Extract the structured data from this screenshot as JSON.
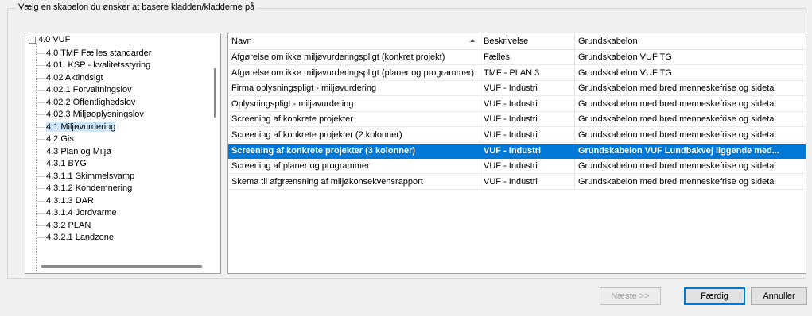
{
  "group_title": "Vælg en skabelon du ønsker at basere kladden/kladderne på",
  "tree": {
    "root": "4.0 VUF",
    "items": [
      "4.0 TMF Fælles standarder",
      "4.01. KSP - kvalitetsstyring",
      "4.02 Aktindsigt",
      "4.02.1 Forvaltningslov",
      "4.02.2 Offentlighedslov",
      "4.02.3 Miljøoplysningslov",
      "4.1 Miljøvurdering",
      "4.2 Gis",
      "4.3 Plan og Miljø",
      "4.3.1 BYG",
      "4.3.1.1 Skimmelsvamp",
      "4.3.1.2 Kondemnering",
      "4.3.1.3 DAR",
      "4.3.1.4 Jordvarme",
      "4.3.2 PLAN",
      "4.3.2.1 Landzone"
    ],
    "selected_index": 6
  },
  "list": {
    "columns": [
      "Navn",
      "Beskrivelse",
      "Grundskabelon"
    ],
    "rows": [
      [
        "Afgørelse om ikke miljøvurderingspligt (konkret projekt)",
        "Fælles",
        "Grundskabelon VUF TG"
      ],
      [
        "Afgørelse om ikke miljøvurderingspligt (planer og programmer)",
        "TMF - PLAN 3",
        "Grundskabelon VUF TG"
      ],
      [
        "Firma oplysningspligt - miljøvurdering",
        "VUF - Industri",
        "Grundskabelon med bred menneskefrise og sidetal"
      ],
      [
        "Oplysningspligt - miljøvurdering",
        "VUF - Industri",
        "Grundskabelon med bred menneskefrise og sidetal"
      ],
      [
        "Screening af konkrete projekter",
        "VUF - Industri",
        "Grundskabelon med bred menneskefrise og sidetal"
      ],
      [
        "Screening af konkrete projekter (2 kolonner)",
        "VUF - Industri",
        "Grundskabelon med bred menneskefrise og sidetal"
      ],
      [
        "Screening af konkrete projekter (3 kolonner)",
        "VUF - Industri",
        "Grundskabelon VUF Lundbakvej liggende med..."
      ],
      [
        "Screening af planer og programmer",
        "VUF - Industri",
        "Grundskabelon med bred menneskefrise og sidetal"
      ],
      [
        "Skema til afgrænsning af miljøkonsekvensrapport",
        "VUF - Industri",
        "Grundskabelon med bred menneskefrise og sidetal"
      ]
    ],
    "selected_index": 6
  },
  "buttons": {
    "next": "Næste >>",
    "finish": "Færdig",
    "cancel": "Annuller"
  }
}
